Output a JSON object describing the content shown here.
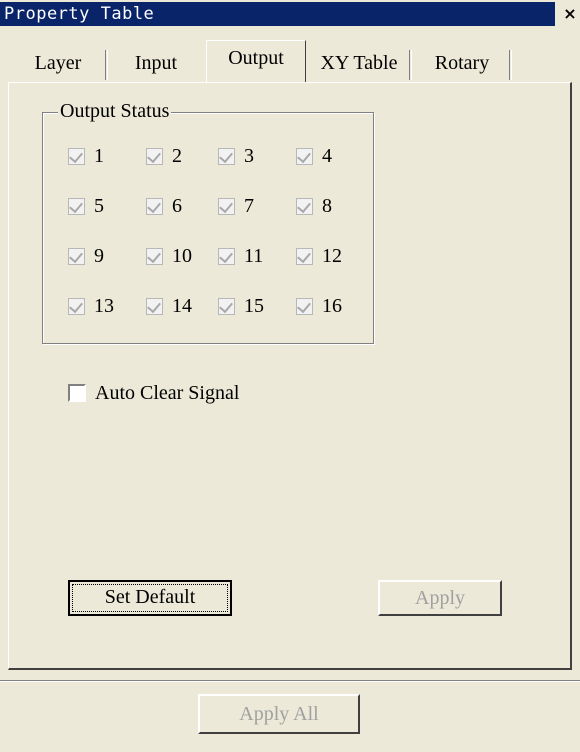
{
  "window": {
    "title": "Property Table",
    "close_label": "×"
  },
  "tabs": [
    {
      "label": "Layer",
      "active": false
    },
    {
      "label": "Input",
      "active": false
    },
    {
      "label": "Output",
      "active": true
    },
    {
      "label": "XY Table",
      "active": false
    },
    {
      "label": "Rotary",
      "active": false
    }
  ],
  "output_status": {
    "label": "Output Status",
    "items": [
      {
        "label": "1",
        "checked": true,
        "enabled": false
      },
      {
        "label": "2",
        "checked": true,
        "enabled": false
      },
      {
        "label": "3",
        "checked": true,
        "enabled": false
      },
      {
        "label": "4",
        "checked": true,
        "enabled": false
      },
      {
        "label": "5",
        "checked": true,
        "enabled": false
      },
      {
        "label": "6",
        "checked": true,
        "enabled": false
      },
      {
        "label": "7",
        "checked": true,
        "enabled": false
      },
      {
        "label": "8",
        "checked": true,
        "enabled": false
      },
      {
        "label": "9",
        "checked": true,
        "enabled": false
      },
      {
        "label": "10",
        "checked": true,
        "enabled": false
      },
      {
        "label": "11",
        "checked": true,
        "enabled": false
      },
      {
        "label": "12",
        "checked": true,
        "enabled": false
      },
      {
        "label": "13",
        "checked": true,
        "enabled": false
      },
      {
        "label": "14",
        "checked": true,
        "enabled": false
      },
      {
        "label": "15",
        "checked": true,
        "enabled": false
      },
      {
        "label": "16",
        "checked": true,
        "enabled": false
      }
    ]
  },
  "auto_clear": {
    "label": "Auto Clear Signal",
    "checked": false
  },
  "buttons": {
    "set_default": "Set Default",
    "apply": "Apply",
    "apply_all": "Apply All"
  }
}
